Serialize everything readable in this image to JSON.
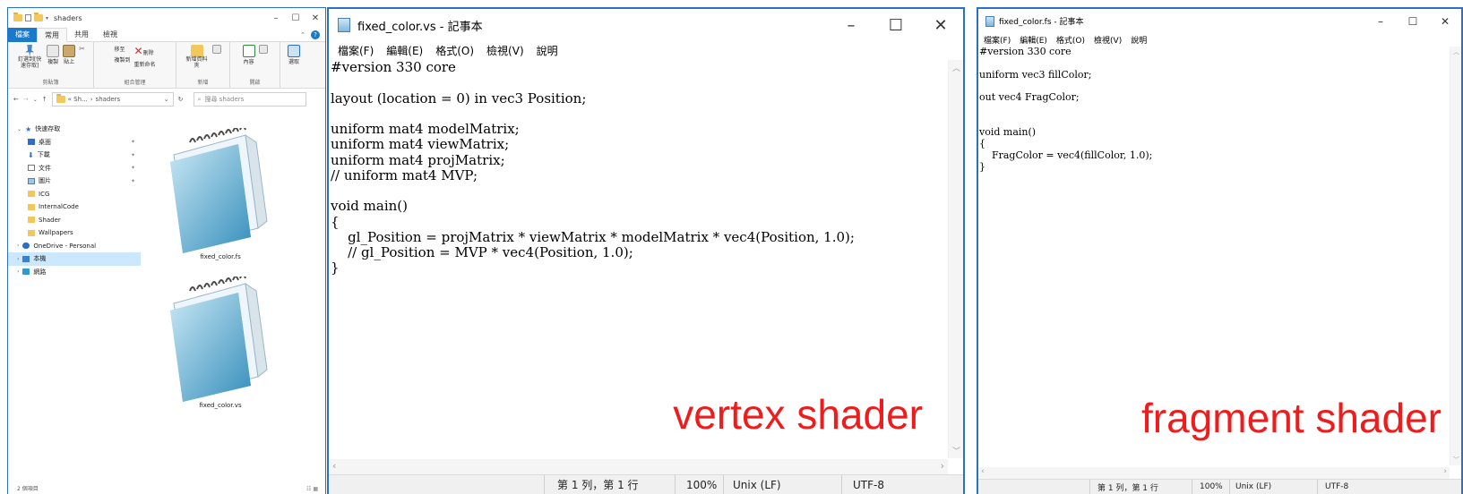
{
  "explorer": {
    "title": "shaders",
    "tabs": [
      "檔案",
      "常用",
      "共用",
      "檢視"
    ],
    "ribbon": {
      "pin_label": "釘選到[快速存取]",
      "copy_label": "複製",
      "paste_label": "貼上",
      "group_clipboard": "剪貼簿",
      "move_label": "移至",
      "copyto_label": "複製到",
      "delete_label": "刪除",
      "rename_label": "重新命名",
      "group_organize": "組合管理",
      "newfolder_label": "新增資料夾",
      "group_new": "新增",
      "props_label": "內容",
      "group_open": "開啟",
      "select_label": "選取"
    },
    "address": {
      "path_prefix": "«  Sh...",
      "sep": "›",
      "current": "shaders"
    },
    "search": {
      "placeholder": "搜尋 shaders"
    },
    "nav": {
      "quick_access": "快速存取",
      "desktop": "桌面",
      "downloads": "下載",
      "documents": "文件",
      "pictures": "圖片",
      "icg": "ICG",
      "internalcode": "InternalCode",
      "shader": "Shader",
      "wallpapers": "Wallpapers",
      "onedrive": "OneDrive - Personal",
      "thispc": "本機",
      "network": "網路"
    },
    "files": [
      "fixed_color.fs",
      "fixed_color.vs"
    ],
    "status_count": "2 個項目"
  },
  "notepad_vs": {
    "title": "fixed_color.vs - 記事本",
    "menu": [
      "檔案(F)",
      "編輯(E)",
      "格式(O)",
      "檢視(V)",
      "說明"
    ],
    "content": "#version 330 core\n\nlayout (location = 0) in vec3 Position;\n\nuniform mat4 modelMatrix;\nuniform mat4 viewMatrix;\nuniform mat4 projMatrix;\n// uniform mat4 MVP;\n\nvoid main()\n{\n    gl_Position = projMatrix * viewMatrix * modelMatrix * vec4(Position, 1.0);\n    // gl_Position = MVP * vec4(Position, 1.0);\n}",
    "status": {
      "pos": "第 1 列，第 1 行",
      "zoom": "100%",
      "eol": "Unix (LF)",
      "enc": "UTF-8"
    },
    "annotation": "vertex shader"
  },
  "notepad_fs": {
    "title": "fixed_color.fs - 記事本",
    "menu": [
      "檔案(F)",
      "編輯(E)",
      "格式(O)",
      "檢視(V)",
      "說明"
    ],
    "content": "#version 330 core\n\nuniform vec3 fillColor;\n\nout vec4 FragColor;\n\n\nvoid main()\n{\n    FragColor = vec4(fillColor, 1.0);\n}",
    "status": {
      "pos": "第 1 列，第 1 行",
      "zoom": "100%",
      "eol": "Unix (LF)",
      "enc": "UTF-8"
    },
    "annotation": "fragment shader"
  },
  "colors": {
    "window_border": "#2b6fc7",
    "annotation": "#ee1c1c",
    "file_tab": "#1979ca"
  }
}
